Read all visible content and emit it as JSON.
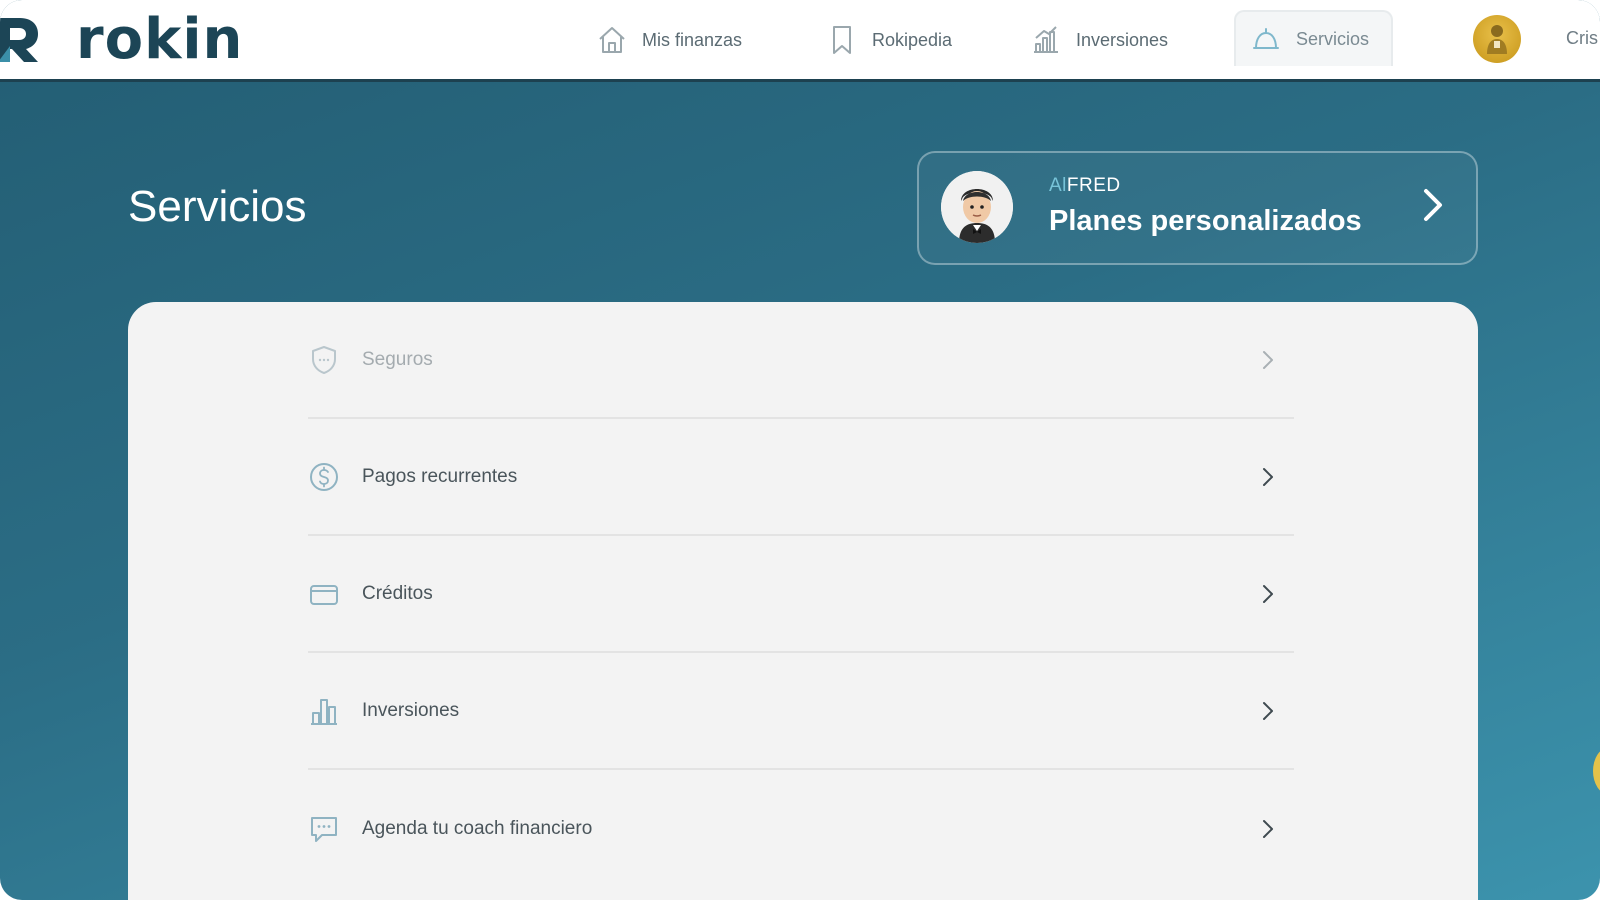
{
  "brand": {
    "name": "rokin"
  },
  "nav": {
    "items": [
      {
        "label": "Mis finanzas",
        "icon": "home-icon"
      },
      {
        "label": "Rokipedia",
        "icon": "bookmark-icon"
      },
      {
        "label": "Inversiones",
        "icon": "bar-chart-icon"
      },
      {
        "label": "Servicios",
        "icon": "bell-icon",
        "active": true
      }
    ],
    "user_name": "Cris"
  },
  "page": {
    "title": "Servicios"
  },
  "alfred": {
    "tag_ai": "Al",
    "tag_rest": "FRED",
    "title": "Planes personalizados"
  },
  "services": [
    {
      "label": "Seguros",
      "icon": "shield-icon",
      "disabled": true
    },
    {
      "label": "Pagos recurrentes",
      "icon": "dollar-coin-icon"
    },
    {
      "label": "Créditos",
      "icon": "credit-card-icon"
    },
    {
      "label": "Inversiones",
      "icon": "bar-chart-icon"
    },
    {
      "label": "Agenda tu coach financiero",
      "icon": "chat-bubble-icon"
    }
  ],
  "colors": {
    "brand_dark": "#1c4556",
    "gradient_start": "#235d73",
    "gradient_end": "#3c93ad",
    "card_bg": "#f3f3f3",
    "accent_gold": "#e4c24a"
  }
}
